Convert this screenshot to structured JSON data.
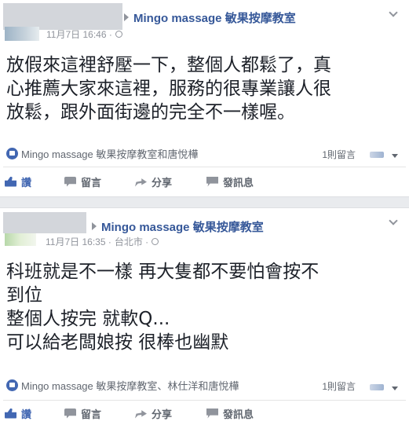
{
  "posts": [
    {
      "page_name": "Mingo massage 敏果按摩教室",
      "timestamp": "11月7日 16:46 · ",
      "location": "",
      "body_lines": [
        "放假來這裡舒壓一下，整個人都鬆了，真",
        "心推薦大家來這裡，服務的很專業讓人很",
        "放鬆，跟外面街邊的完全不一樣喔。"
      ],
      "reactions": "Mingo massage 敏果按摩教室和唐悅樺",
      "comments_count": "1則留言",
      "actions": {
        "like": "讚",
        "comment": "留言",
        "share": "分享",
        "message": "發訊息"
      }
    },
    {
      "page_name": "Mingo massage 敏果按摩教室",
      "timestamp": "11月7日 16:35 · ",
      "location": "台北市 · ",
      "body_lines": [
        "科班就是不一樣 再大隻都不要怕會按不",
        "到位",
        "整個人按完 就軟Q...",
        "可以給老闆娘按 很棒也幽默"
      ],
      "reactions": "Mingo massage 敏果按摩教室、林仕洋和唐悅樺",
      "comments_count": "1則留言",
      "actions": {
        "like": "讚",
        "comment": "留言",
        "share": "分享",
        "message": "發訊息"
      }
    }
  ],
  "colors": {
    "link": "#365899",
    "liked": "#4267b2",
    "muted": "#90949c",
    "separator": "#e9ebee"
  },
  "icons": [
    "triangle-right-icon",
    "globe-icon",
    "chevron-down-icon",
    "like-icon",
    "comment-icon",
    "share-icon",
    "message-icon"
  ]
}
